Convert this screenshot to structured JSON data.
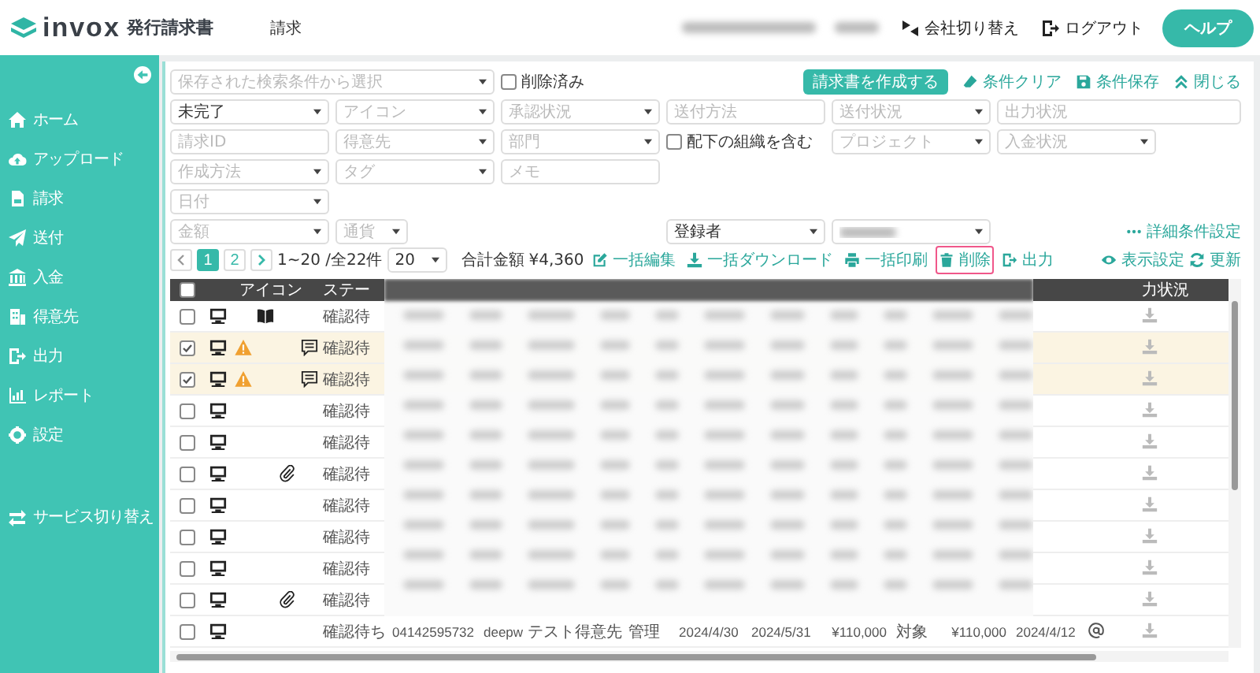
{
  "header": {
    "brand": "invox",
    "app_name": "発行請求書",
    "nav": [
      {
        "label": "請求"
      }
    ],
    "company_switch": "会社切り替え",
    "logout": "ログアウト",
    "help": "ヘルプ"
  },
  "sidebar": {
    "items": [
      {
        "kind": "home",
        "label": "ホーム"
      },
      {
        "kind": "upload",
        "label": "アップロード"
      },
      {
        "kind": "invoice",
        "label": "請求"
      },
      {
        "kind": "send",
        "label": "送付"
      },
      {
        "kind": "payment",
        "label": "入金"
      },
      {
        "kind": "customer",
        "label": "得意先"
      },
      {
        "kind": "output",
        "label": "出力"
      },
      {
        "kind": "report",
        "label": "レポート"
      },
      {
        "kind": "settings",
        "label": "設定"
      },
      {
        "kind": "switch",
        "label": "サービス切り替え"
      }
    ]
  },
  "search_panel": {
    "rows": [
      [
        {
          "kind": "select",
          "placeholder": "保存された検索条件から選択"
        },
        "",
        {
          "kind": "checkbox",
          "label": "削除済み",
          "checked": false
        }
      ],
      [
        {
          "kind": "select",
          "value": "未完了"
        },
        {
          "kind": "select",
          "placeholder": "アイコン"
        },
        {
          "kind": "select",
          "placeholder": "承認状況"
        },
        {
          "kind": "input",
          "placeholder": "送付方法"
        },
        {
          "kind": "select",
          "placeholder": "送付状況"
        },
        {
          "kind": "input",
          "placeholder": "出力状況"
        }
      ],
      [
        {
          "kind": "input",
          "placeholder": "請求ID"
        },
        {
          "kind": "select",
          "placeholder": "得意先"
        },
        {
          "kind": "select",
          "placeholder": "部門"
        },
        {
          "kind": "checkbox",
          "label": "配下の組織を含む",
          "checked": false
        },
        {
          "kind": "select",
          "placeholder": "プロジェクト"
        },
        {
          "kind": "select",
          "placeholder": "入金状況"
        }
      ],
      [
        {
          "kind": "select",
          "placeholder": "作成方法"
        },
        {
          "kind": "select",
          "placeholder": "タグ"
        },
        {
          "kind": "input",
          "placeholder": "メモ"
        }
      ],
      [
        {
          "kind": "select",
          "placeholder": "日付"
        }
      ],
      [
        {
          "kind": "select",
          "placeholder": "金額"
        },
        {
          "kind": "select",
          "placeholder": "通貨"
        },
        "",
        {
          "kind": "select",
          "value": "登録者"
        },
        {
          "kind": "redacted"
        }
      ]
    ],
    "actions": [
      {
        "kind": "create",
        "label": "請求書を作成する"
      },
      {
        "kind": "clear",
        "label": "条件クリア"
      },
      {
        "kind": "save",
        "label": "条件保存"
      },
      {
        "kind": "close",
        "label": "閉じる"
      }
    ],
    "detail_link": "詳細条件設定"
  },
  "toolbar": {
    "pages": [
      {
        "label": "1",
        "selected": true
      },
      {
        "label": "2",
        "selected": false
      }
    ],
    "range": "1~20 /全22件",
    "page_size": "20",
    "total_label": "合計金額",
    "total": "¥4,360",
    "actions": [
      {
        "kind": "edit",
        "label": "一括編集",
        "highlighted": false
      },
      {
        "kind": "download",
        "label": "一括ダウンロード",
        "highlighted": false
      },
      {
        "kind": "print",
        "label": "一括印刷",
        "highlighted": false
      },
      {
        "kind": "delete",
        "label": "削除",
        "highlighted": true
      },
      {
        "kind": "export",
        "label": "出力",
        "highlighted": false
      }
    ],
    "right_actions": [
      {
        "kind": "view",
        "label": "表示設定"
      },
      {
        "kind": "refresh",
        "label": "更新"
      }
    ]
  },
  "table": {
    "select_all": false,
    "columns": [
      {
        "label": "アイコン"
      },
      {
        "label": "ステー"
      },
      {
        "label": "力状況"
      }
    ],
    "rows": [
      {
        "checked": false,
        "warning": false,
        "book": true,
        "attachment": false,
        "comment": false,
        "status": "確認待"
      },
      {
        "checked": true,
        "warning": true,
        "book": false,
        "attachment": false,
        "comment": true,
        "status": "確認待"
      },
      {
        "checked": true,
        "warning": true,
        "book": false,
        "attachment": false,
        "comment": true,
        "status": "確認待"
      },
      {
        "checked": false,
        "warning": false,
        "book": false,
        "attachment": false,
        "comment": false,
        "status": "確認待"
      },
      {
        "checked": false,
        "warning": false,
        "book": false,
        "attachment": false,
        "comment": false,
        "status": "確認待"
      },
      {
        "checked": false,
        "warning": false,
        "book": false,
        "attachment": true,
        "comment": false,
        "status": "確認待"
      },
      {
        "checked": false,
        "warning": false,
        "book": false,
        "attachment": false,
        "comment": false,
        "status": "確認待"
      },
      {
        "checked": false,
        "warning": false,
        "book": false,
        "attachment": false,
        "comment": false,
        "status": "確認待"
      },
      {
        "checked": false,
        "warning": false,
        "book": false,
        "attachment": false,
        "comment": false,
        "status": "確認待"
      },
      {
        "checked": false,
        "warning": false,
        "book": false,
        "attachment": true,
        "comment": false,
        "status": "確認待"
      },
      {
        "checked": false,
        "warning": false,
        "book": false,
        "attachment": false,
        "comment": false,
        "status": "確認待ち",
        "cells": [
          "04142595732",
          "deepw",
          "テスト得意先",
          "管理",
          "2024/4/30",
          "2024/5/31",
          "¥110,000",
          "対象",
          "¥110,000",
          "2024/4/12"
        ]
      }
    ]
  }
}
